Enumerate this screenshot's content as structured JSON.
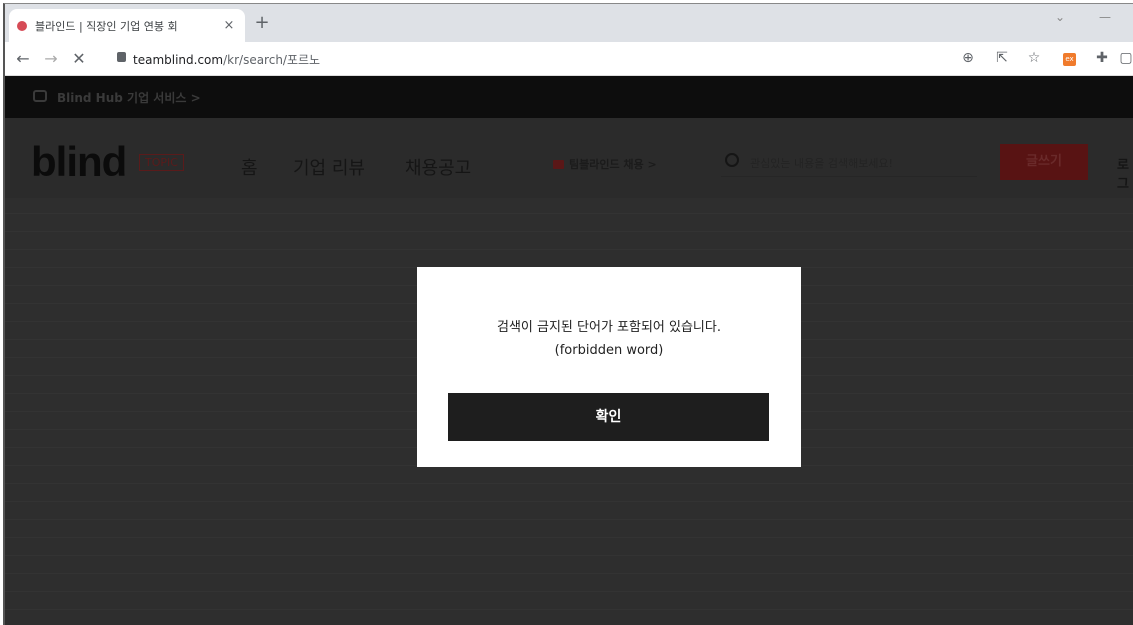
{
  "browser": {
    "tab_title": "블라인드 | 직장인 기업 연봉 회",
    "tab_close": "×",
    "new_tab": "+",
    "url_host": "teamblind.com",
    "url_path": "/kr/search/포르노",
    "min": "—",
    "max": "✓",
    "icons": [
      "back-icon",
      "forward-icon",
      "stop-icon",
      "lock-icon",
      "zoom-icon",
      "share-icon",
      "star-icon",
      "extension-icon",
      "puzzle-icon",
      "window-icon"
    ]
  },
  "page": {
    "hub_text": "Blind Hub 기업 서비스 >",
    "logo": "blind",
    "topic": "TOPIC",
    "nav": [
      "홈",
      "기업 리뷰",
      "채용공고"
    ],
    "recruit": "팀블라인드 채용 >",
    "search_placeholder": "관심있는 내용을 검색해보세요!",
    "write": "글쓰기",
    "login": "로그"
  },
  "modal": {
    "message_line1": "검색이 금지된 단어가 포함되어 있습니다.",
    "message_line2": "(forbidden word)",
    "confirm": "확인"
  },
  "colors": {
    "overlay": "#2e2e2e",
    "accent": "#d64b56"
  }
}
